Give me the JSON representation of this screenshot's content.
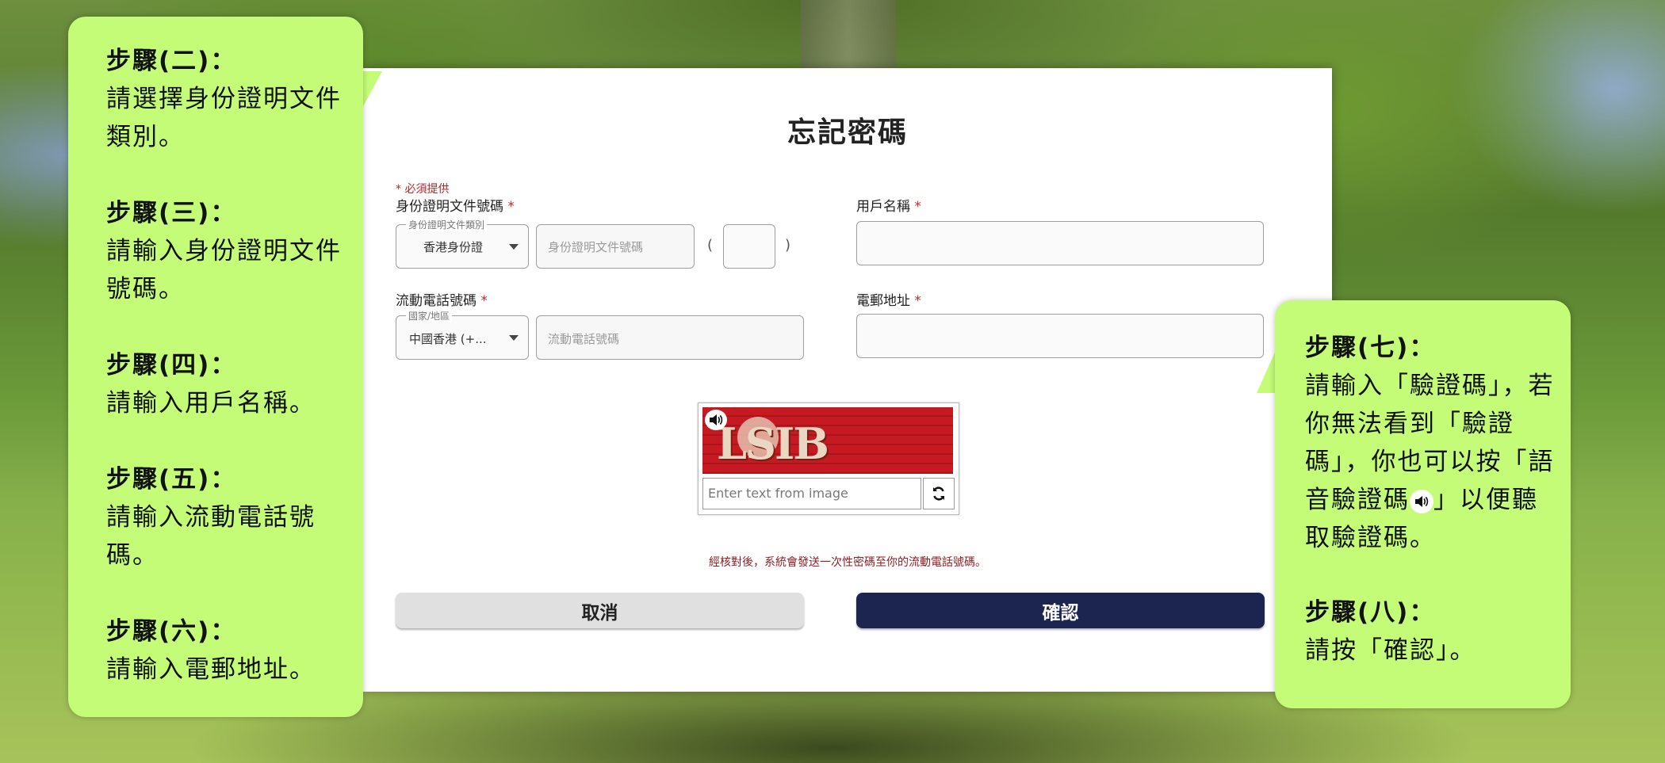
{
  "page": {
    "title": "忘記密碼",
    "required_note": "* 必須提供"
  },
  "fields": {
    "id_number": {
      "label": "身份證明文件號碼",
      "required_star": "*",
      "doc_type_floating": "身份證明文件類別",
      "doc_type_value": "香港身份證",
      "id_placeholder": "身份證明文件號碼",
      "paren_open": "(",
      "paren_close": ")"
    },
    "username": {
      "label": "用戶名稱",
      "required_star": "*"
    },
    "mobile": {
      "label": "流動電話號碼",
      "required_star": "*",
      "region_floating": "國家/地區",
      "region_value": "中國香港 (+...",
      "phone_placeholder": "流動電話號碼"
    },
    "email": {
      "label": "電郵地址",
      "required_star": "*"
    }
  },
  "captcha": {
    "image_text": "LSIB",
    "input_placeholder": "Enter text from image",
    "audio_icon": "speaker-icon",
    "refresh_icon": "refresh-icon"
  },
  "notice": "經核對後，系統會發送一次性密碼至你的流動電話號碼。",
  "buttons": {
    "cancel": "取消",
    "confirm": "確認"
  },
  "callouts": {
    "left": [
      {
        "head": "步驟(二)：",
        "body": "請選擇身份證明文件類別。"
      },
      {
        "head": "步驟(三)：",
        "body": "請輸入身份證明文件號碼。"
      },
      {
        "head": "步驟(四)：",
        "body": "請輸入用戶名稱。"
      },
      {
        "head": "步驟(五)：",
        "body": "請輸入流動電話號碼。"
      },
      {
        "head": "步驟(六)：",
        "body": "請輸入電郵地址。"
      }
    ],
    "right": [
      {
        "head": "步驟(七)：",
        "body_before_icon": "請輸入「驗證碼」，若你無法看到「驗證碼」，你也可以按「語音驗證碼",
        "body_after_icon": "」以便聽取驗證碼。"
      },
      {
        "head": "步驟(八)：",
        "body": "請按「確認」。"
      }
    ]
  },
  "colors": {
    "callout_bg": "#c4fc78",
    "confirm_bg": "#1c254f",
    "required_red": "#c0282c",
    "notice_red": "#8f1e22"
  }
}
